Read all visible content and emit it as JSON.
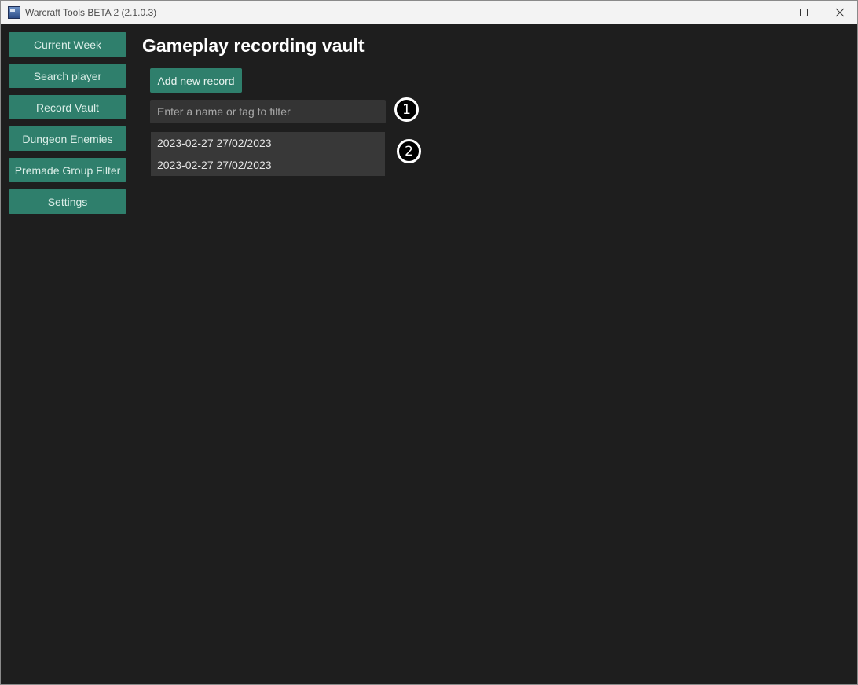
{
  "window": {
    "title": "Warcraft Tools BETA 2 (2.1.0.3)",
    "icon": "app-icon",
    "controls": [
      "minimize-icon",
      "maximize-icon",
      "close-icon"
    ]
  },
  "sidebar": {
    "items": [
      {
        "label": "Current Week"
      },
      {
        "label": "Search player"
      },
      {
        "label": "Record Vault"
      },
      {
        "label": "Dungeon Enemies"
      },
      {
        "label": "Premade Group Filter"
      },
      {
        "label": "Settings"
      }
    ]
  },
  "main": {
    "title": "Gameplay recording vault",
    "add_button_label": "Add new record",
    "filter": {
      "value": "",
      "placeholder": "Enter a name or tag to filter"
    },
    "records": [
      {
        "label": "2023-02-27 27/02/2023"
      },
      {
        "label": "2023-02-27 27/02/2023"
      }
    ]
  },
  "annotations": {
    "marker_1": "1",
    "marker_2": "2"
  },
  "colors": {
    "accent": "#2f7f6c",
    "background": "#1e1e1e",
    "input_background": "#343434",
    "list_background": "#383838"
  }
}
